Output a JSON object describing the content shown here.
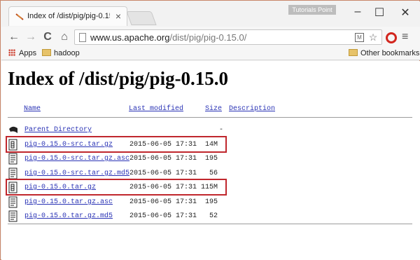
{
  "browser": {
    "tab_title": "Index of /dist/pig/pig-0.15",
    "tab_close": "×",
    "brand": "Tutorials Point",
    "window_controls": {
      "minimize": "–",
      "maximize": "☐",
      "close": "✕"
    },
    "nav": {
      "back": "←",
      "forward": "→",
      "reload": "C",
      "home": "⌂"
    },
    "url_domain": "www.us.apache.org",
    "url_path": "/dist/pig/pig-0.15.0/",
    "menu": "≡",
    "icons": [
      "back-icon",
      "forward-icon",
      "reload-icon",
      "home-icon",
      "page-icon",
      "ext-icon",
      "star-icon",
      "opera-icon",
      "menu-icon"
    ]
  },
  "bookmarks": {
    "apps": "Apps",
    "hadoop": "hadoop",
    "other": "Other bookmarks"
  },
  "page": {
    "title": "Index of /dist/pig/pig-0.15.0",
    "headers": {
      "name": "Name",
      "modified": "Last modified",
      "size": "Size",
      "description": "Description"
    },
    "parent": {
      "name": "Parent Directory",
      "size": "-"
    },
    "files": [
      {
        "name": "pig-0.15.0-src.tar.gz",
        "modified": "2015-06-05 17:31",
        "size": "14M",
        "highlighted": true,
        "kind": "archive"
      },
      {
        "name": "pig-0.15.0-src.tar.gz.asc",
        "modified": "2015-06-05 17:31",
        "size": "195",
        "highlighted": false,
        "kind": "text"
      },
      {
        "name": "pig-0.15.0-src.tar.gz.md5",
        "modified": "2015-06-05 17:31",
        "size": "56",
        "highlighted": false,
        "kind": "text"
      },
      {
        "name": "pig-0.15.0.tar.gz",
        "modified": "2015-06-05 17:31",
        "size": "115M",
        "highlighted": true,
        "kind": "archive"
      },
      {
        "name": "pig-0.15.0.tar.gz.asc",
        "modified": "2015-06-05 17:31",
        "size": "195",
        "highlighted": false,
        "kind": "text"
      },
      {
        "name": "pig-0.15.0.tar.gz.md5",
        "modified": "2015-06-05 17:31",
        "size": "52",
        "highlighted": false,
        "kind": "text"
      }
    ],
    "link_color": "#2a33b5",
    "highlight_color": "#c0272d"
  }
}
